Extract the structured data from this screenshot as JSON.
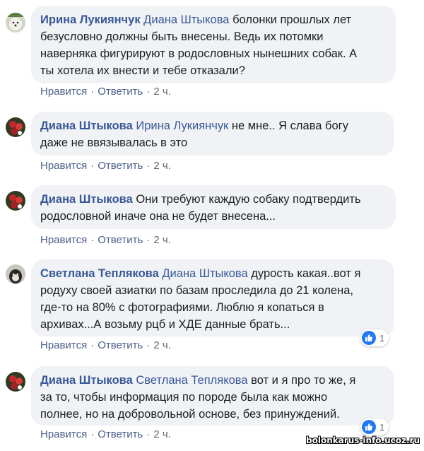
{
  "comments": [
    {
      "author": "Ирина Лукиянчук",
      "mention": "Диана Штыкова",
      "lines": [
        "болонки прошлых лет",
        "безусловно должны быть внесены. Ведь их потомки",
        "наверняка фигурируют в родословных нынешних собак. А",
        "ты хотела их внести и тебе отказали?"
      ],
      "like": "Нравится",
      "reply": "Ответить",
      "time": "2 ч."
    },
    {
      "author": "Диана Штыкова",
      "mention": "Ирина Лукиянчук",
      "lines": [
        "не мне.. Я слава богу",
        "даже не ввязывалась в это"
      ],
      "like": "Нравится",
      "reply": "Ответить",
      "time": "2 ч."
    },
    {
      "author": "Диана Штыкова",
      "mention": "",
      "lines": [
        "Они требуют каждую собаку подтвердить",
        "родословной иначе она не будет внесена..."
      ],
      "like": "Нравится",
      "reply": "Ответить",
      "time": "2 ч."
    },
    {
      "author": "Светлана Теплякова",
      "mention": "Диана Штыкова",
      "lines": [
        "дурость какая..вот я",
        "родуху своей азиатки по базам проследила до 21 колена,",
        "где-то на 80% с фотографиями. Люблю я копаться в",
        "архивах...А возьму рцб и ХДЕ данные брать..."
      ],
      "like": "Нравится",
      "reply": "Ответить",
      "time": "2 ч.",
      "reactions": "1"
    },
    {
      "author": "Диана Штыкова",
      "mention": "Светлана Теплякова",
      "lines": [
        "вот и я про то же, я",
        "за то, чтобы информация по породе была как можно",
        "полнее, но на добровольной основе, без принуждений."
      ],
      "like": "Нравится",
      "reply": "Ответить",
      "time": "2 ч.",
      "reactions": "1"
    }
  ],
  "watermark": "bolonkarus-info.ucoz.ru",
  "colors": {
    "link": "#385898",
    "bubble": "#f0f2f5",
    "like_blue": "#2078f4"
  }
}
